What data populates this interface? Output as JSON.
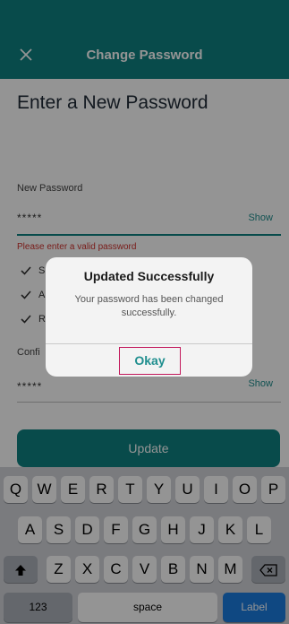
{
  "header": {
    "title": "Change Password"
  },
  "page": {
    "title": "Enter a New Password",
    "new_password": {
      "label": "New Password",
      "value": "*****",
      "show_label": "Show"
    },
    "error_text": "Please enter a valid password",
    "requirement_partials": [
      "S",
      "A",
      "R"
    ],
    "confirm_password": {
      "label_partial": "Confi",
      "value": "*****",
      "show_label": "Show"
    },
    "update_label": "Update"
  },
  "dialog": {
    "title": "Updated Successfully",
    "message": "Your password has been changed successfully.",
    "ok_label": "Okay"
  },
  "keyboard": {
    "row1": [
      "Q",
      "W",
      "E",
      "R",
      "T",
      "Y",
      "U",
      "I",
      "O",
      "P"
    ],
    "row2": [
      "A",
      "S",
      "D",
      "F",
      "G",
      "H",
      "J",
      "K",
      "L"
    ],
    "row3": [
      "Z",
      "X",
      "C",
      "V",
      "B",
      "N",
      "M"
    ],
    "numbers_label": "123",
    "space_label": "space",
    "action_label": "Label"
  },
  "colors": {
    "brand": "#0f8282",
    "error": "#d0312d",
    "accent_key": "#1a7de0"
  }
}
